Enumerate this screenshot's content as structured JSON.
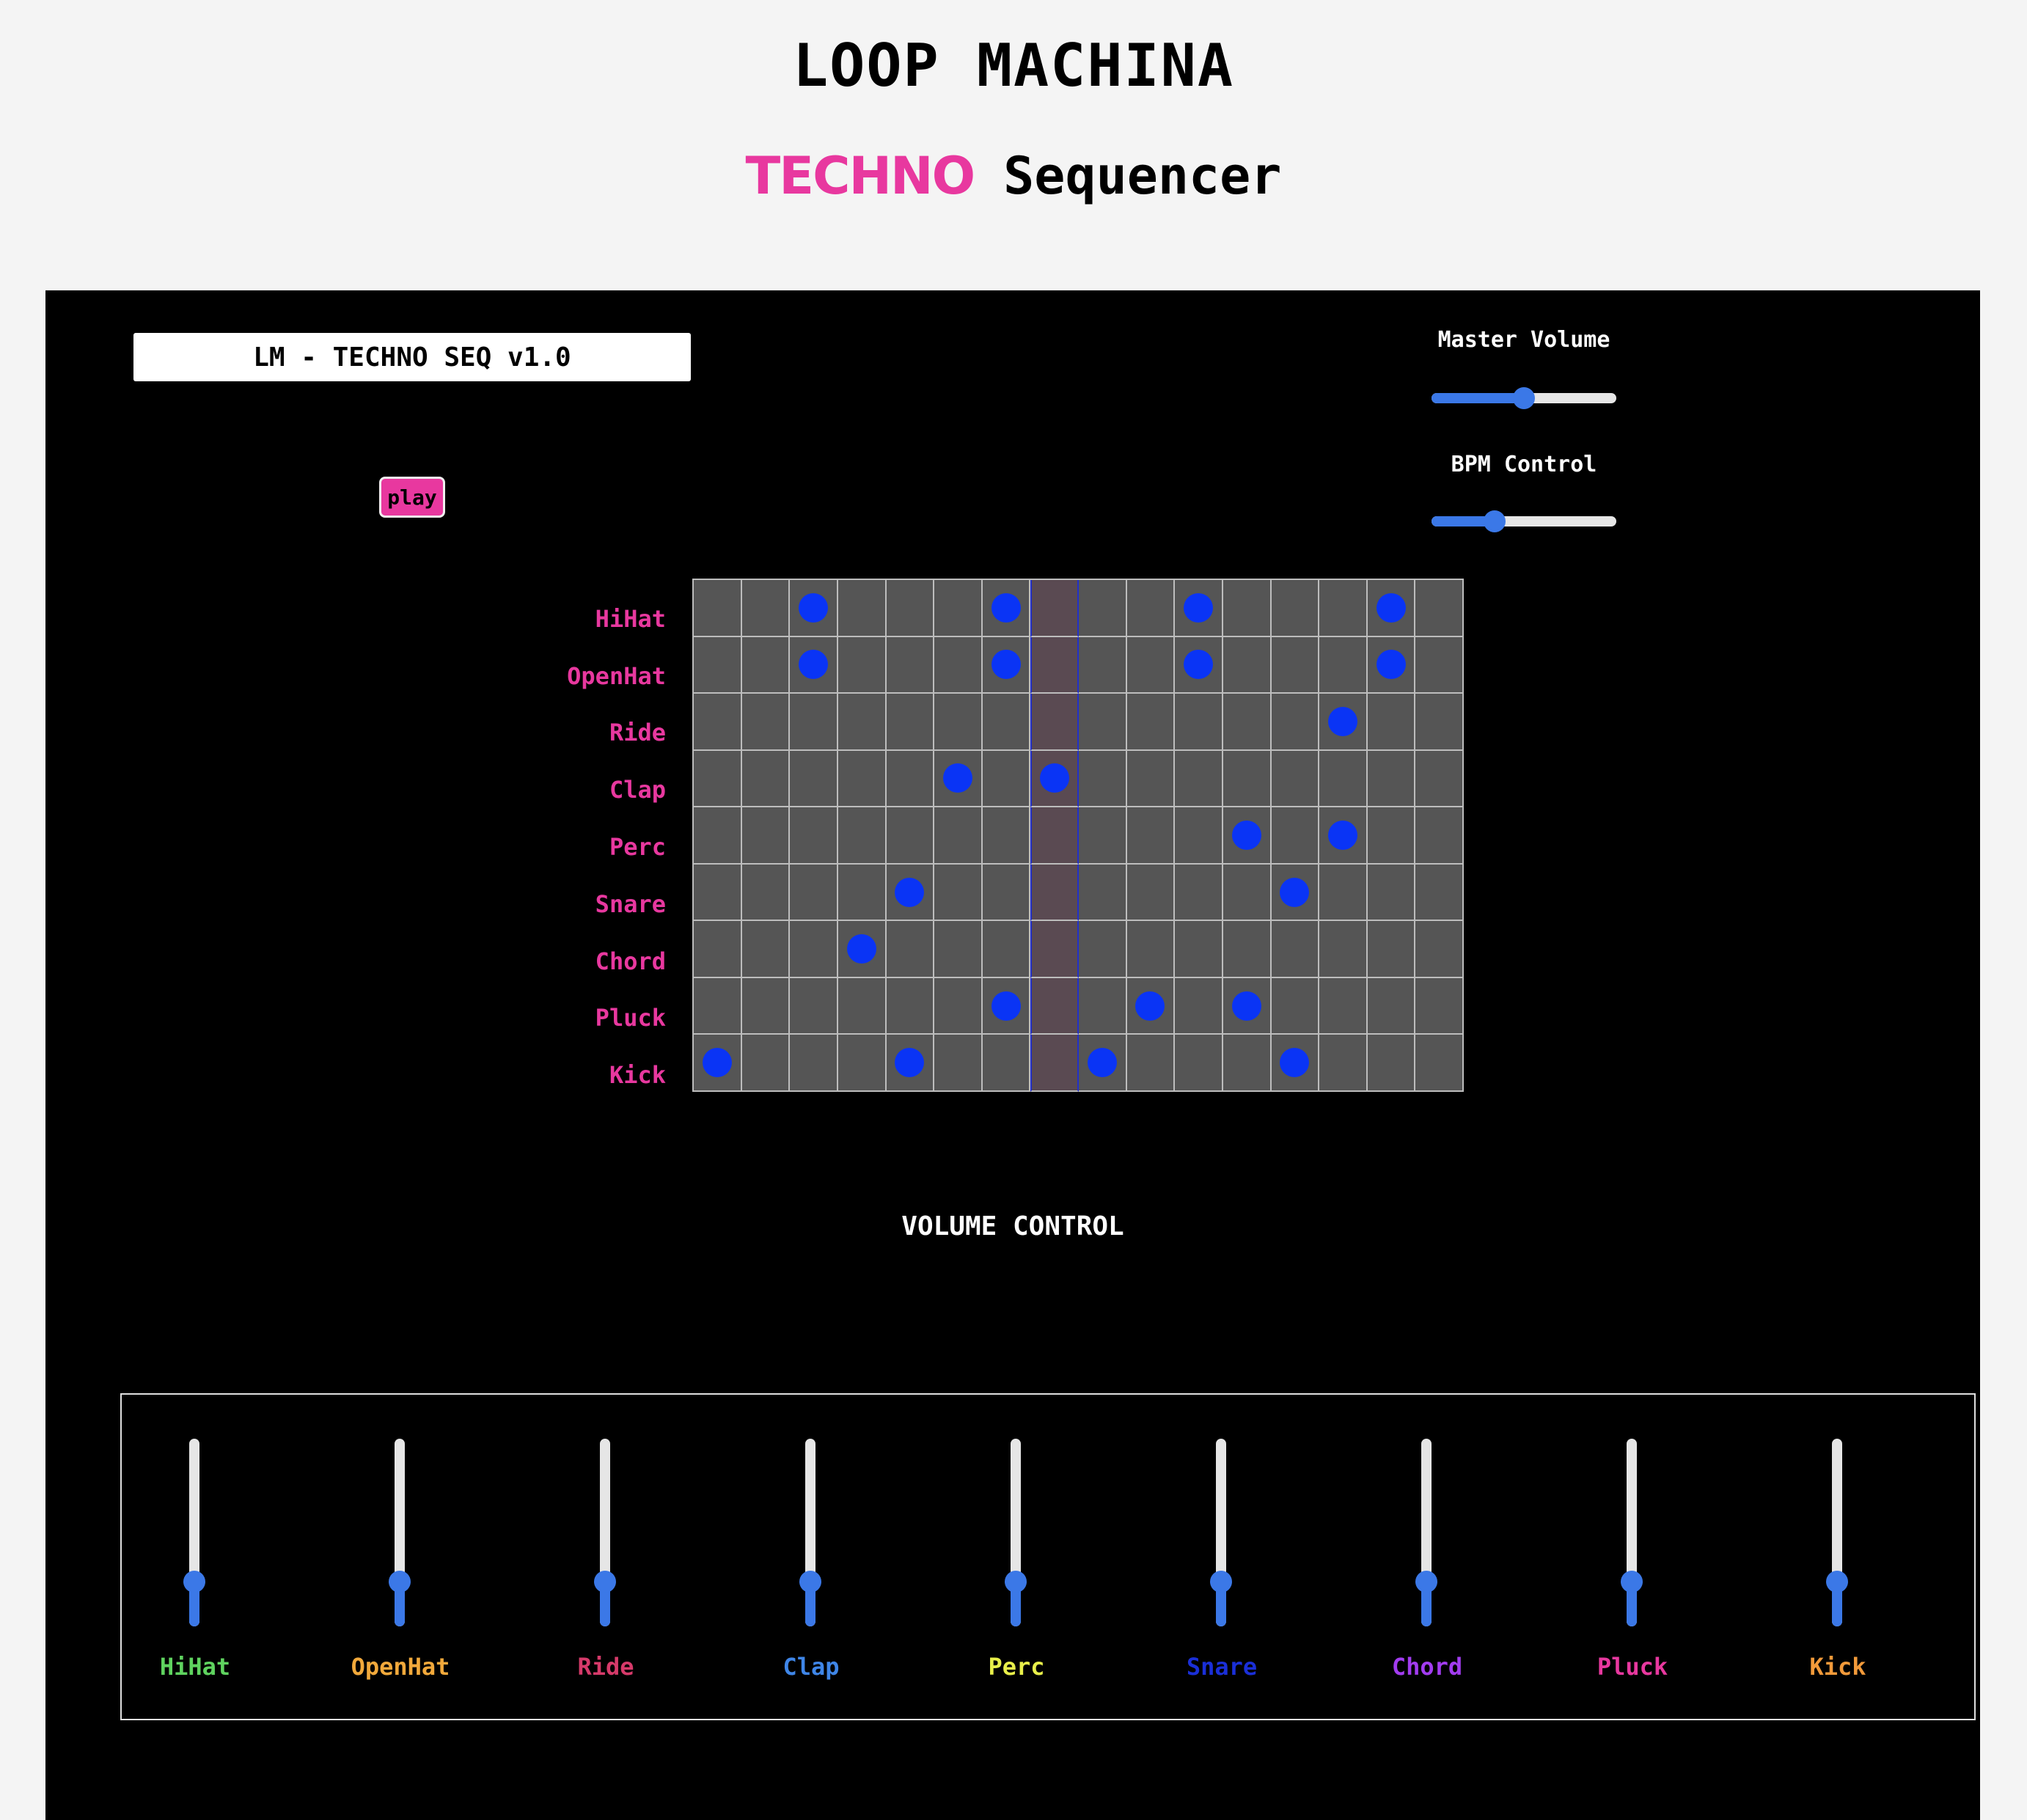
{
  "header": {
    "title": "LOOP MACHINA",
    "subtitle_accent": "TECHNO",
    "subtitle_rest": "Sequencer",
    "accent_color": "#e8389f"
  },
  "panel": {
    "version_label": "LM - TECHNO SEQ v1.0",
    "play_label": "play",
    "master_volume": {
      "label": "Master Volume",
      "value": 0.5
    },
    "bpm": {
      "label": "BPM Control",
      "value": 0.34
    }
  },
  "sequencer": {
    "steps": 16,
    "current_step": 8,
    "tracks": [
      {
        "name": "HiHat",
        "active_steps": [
          3,
          7,
          11,
          15
        ]
      },
      {
        "name": "OpenHat",
        "active_steps": [
          3,
          7,
          11,
          15
        ]
      },
      {
        "name": "Ride",
        "active_steps": [
          14
        ]
      },
      {
        "name": "Clap",
        "active_steps": [
          6,
          8
        ]
      },
      {
        "name": "Perc",
        "active_steps": [
          12,
          14
        ]
      },
      {
        "name": "Snare",
        "active_steps": [
          5,
          13
        ]
      },
      {
        "name": "Chord",
        "active_steps": [
          4
        ]
      },
      {
        "name": "Pluck",
        "active_steps": [
          7,
          10,
          12
        ]
      },
      {
        "name": "Kick",
        "active_steps": [
          1,
          5,
          9,
          13
        ]
      }
    ]
  },
  "mixer": {
    "title": "VOLUME CONTROL",
    "channels": [
      {
        "name": "HiHat",
        "color": "#5fd35f",
        "level": 0.24
      },
      {
        "name": "OpenHat",
        "color": "#f2a93b",
        "level": 0.24
      },
      {
        "name": "Ride",
        "color": "#d63a6a",
        "level": 0.24
      },
      {
        "name": "Clap",
        "color": "#3f86e8",
        "level": 0.24
      },
      {
        "name": "Perc",
        "color": "#e8ef4a",
        "level": 0.24
      },
      {
        "name": "Snare",
        "color": "#1a2fd8",
        "level": 0.24
      },
      {
        "name": "Chord",
        "color": "#a23cf0",
        "level": 0.24
      },
      {
        "name": "Pluck",
        "color": "#e8389f",
        "level": 0.24
      },
      {
        "name": "Kick",
        "color": "#f29a3a",
        "level": 0.24
      }
    ]
  }
}
